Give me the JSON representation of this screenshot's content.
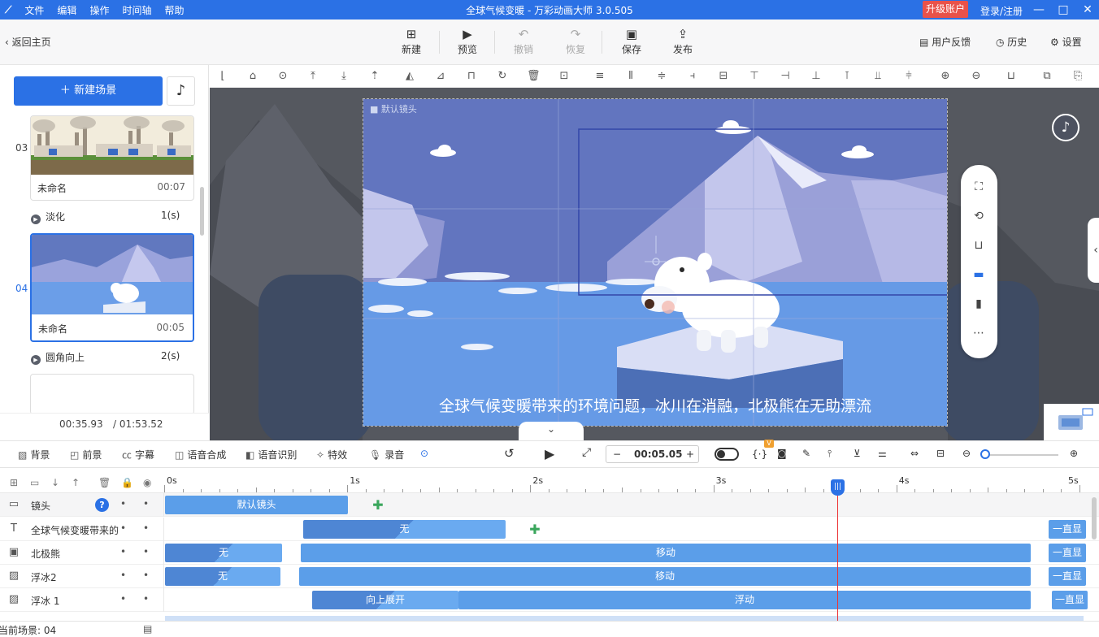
{
  "titlebar": {
    "menu": [
      "文件",
      "编辑",
      "操作",
      "时间轴",
      "帮助"
    ],
    "title": "全球气候变暖 - 万彩动画大师 3.0.505",
    "upgrade": "升级账户",
    "login": "登录/注册"
  },
  "toolbar": {
    "back": "返回主页",
    "new": "新建",
    "preview": "预览",
    "undo": "撤销",
    "redo": "恢复",
    "save": "保存",
    "publish": "发布",
    "feedback": "用户反馈",
    "history": "历史",
    "settings": "设置"
  },
  "scenes": {
    "new_scene": "新建场景",
    "items": [
      {
        "num": "03",
        "name": "未命名",
        "time": "00:07",
        "transition": "淡化",
        "trans_dur": "1(s)"
      },
      {
        "num": "04",
        "name": "未命名",
        "time": "00:05",
        "transition": "圆角向上",
        "trans_dur": "2(s)"
      }
    ],
    "current_time": "00:35.93",
    "total_time": "/ 01:53.52"
  },
  "canvas": {
    "camera_label": "默认镜头",
    "subtitle": "全球气候变暖带来的环境问题，冰川在消融，北极熊在无助漂流"
  },
  "controls": {
    "background": "背景",
    "foreground": "前景",
    "caption": "字幕",
    "tts": "语音合成",
    "asr": "语音识别",
    "effects": "特效",
    "record": "录音",
    "timecode": "00:05.05",
    "vip_badge": "V"
  },
  "timeline": {
    "ruler": [
      "0s",
      "1s",
      "2s",
      "3s",
      "4s",
      "5s"
    ],
    "tracks": [
      {
        "name": "镜头",
        "blocks": [
          {
            "label": "默认镜头"
          }
        ]
      },
      {
        "name": "全球气候变暖带来的",
        "blocks": [
          {
            "label": "无"
          }
        ],
        "always": "一直显"
      },
      {
        "name": "北极熊",
        "blocks": [
          {
            "label": "无"
          },
          {
            "label": "移动"
          }
        ],
        "always": "一直显"
      },
      {
        "name": "浮冰2",
        "blocks": [
          {
            "label": "无"
          },
          {
            "label": "移动"
          }
        ],
        "always": "一直显"
      },
      {
        "name": "浮冰 1",
        "blocks": [
          {
            "label": "向上展开"
          },
          {
            "label": "浮动"
          }
        ],
        "always": "一直显"
      }
    ],
    "help_icon": "?"
  },
  "status": {
    "current_scene": "当前场景: 04"
  },
  "colors": {
    "accent": "#2b71e5",
    "upgrade": "#e9524a",
    "block": "#5b9ee9",
    "playhead": "#e33333"
  }
}
